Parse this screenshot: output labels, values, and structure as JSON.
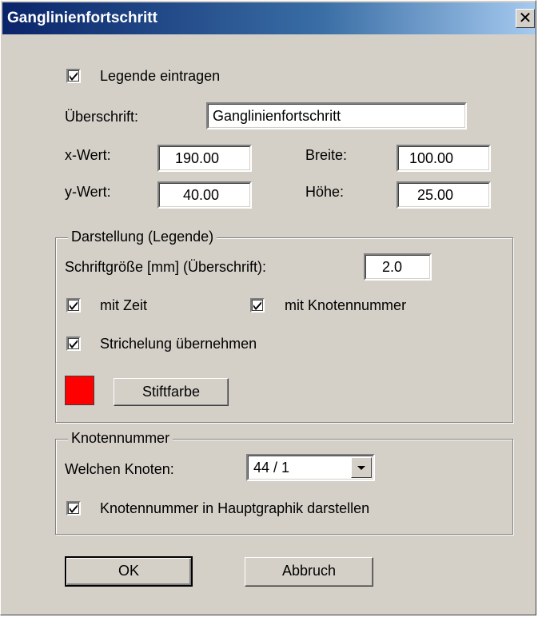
{
  "dialog": {
    "title": "Ganglinienfortschritt",
    "close_symbol": "✕"
  },
  "legend": {
    "checkbox_label": "Legende eintragen",
    "checked": true
  },
  "heading": {
    "label": "Überschrift:",
    "value": "Ganglinienfortschritt"
  },
  "position": {
    "x_label": "x-Wert:",
    "x_value": "190.00",
    "y_label": "y-Wert:",
    "y_value": "40.00",
    "width_label": "Breite:",
    "width_value": "100.00",
    "height_label": "Höhe:",
    "height_value": "25.00"
  },
  "display_group": {
    "title": "Darstellung (Legende)",
    "font_size_label": "Schriftgröße [mm] (Überschrift):",
    "font_size_value": "2.0",
    "with_time_label": "mit Zeit",
    "with_time_checked": true,
    "with_node_number_label": "mit Knotennummer",
    "with_node_number_checked": true,
    "dash_label": "Strichelung übernehmen",
    "dash_checked": true,
    "pen_color": "#ff0000",
    "pen_color_button": "Stiftfarbe"
  },
  "node_group": {
    "title": "Knotennummer",
    "which_node_label": "Welchen Knoten:",
    "which_node_value": "44 / 1",
    "show_in_main_label": "Knotennummer in Hauptgraphik darstellen",
    "show_in_main_checked": true
  },
  "buttons": {
    "ok": "OK",
    "cancel": "Abbruch"
  },
  "icons": {
    "check": "checkmark-icon",
    "dropdown": "triangle-down-icon",
    "close": "close-icon"
  }
}
